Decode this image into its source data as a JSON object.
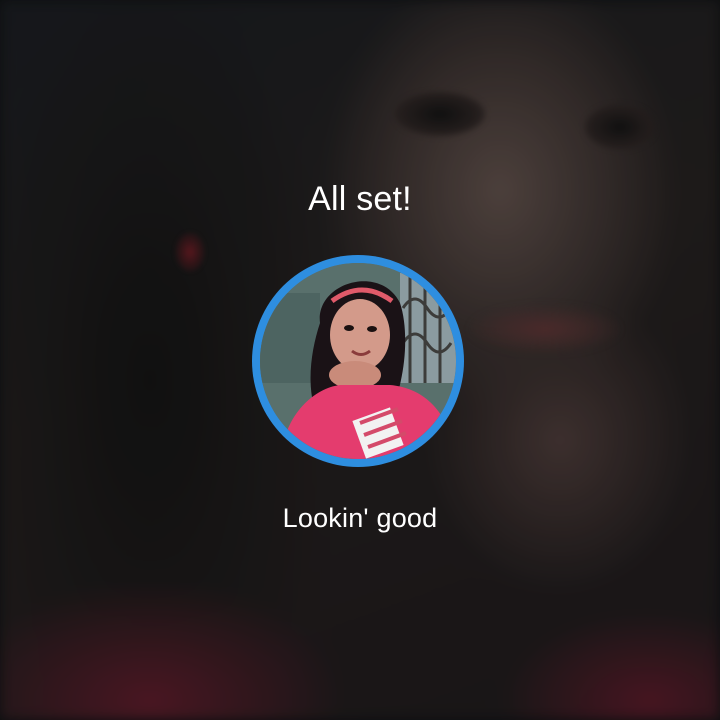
{
  "setup": {
    "title": "All set!",
    "caption": "Lookin' good"
  },
  "colors": {
    "ring": "#2e8ee0",
    "text": "#ffffff"
  },
  "icons": {
    "avatar": "profile-photo"
  }
}
